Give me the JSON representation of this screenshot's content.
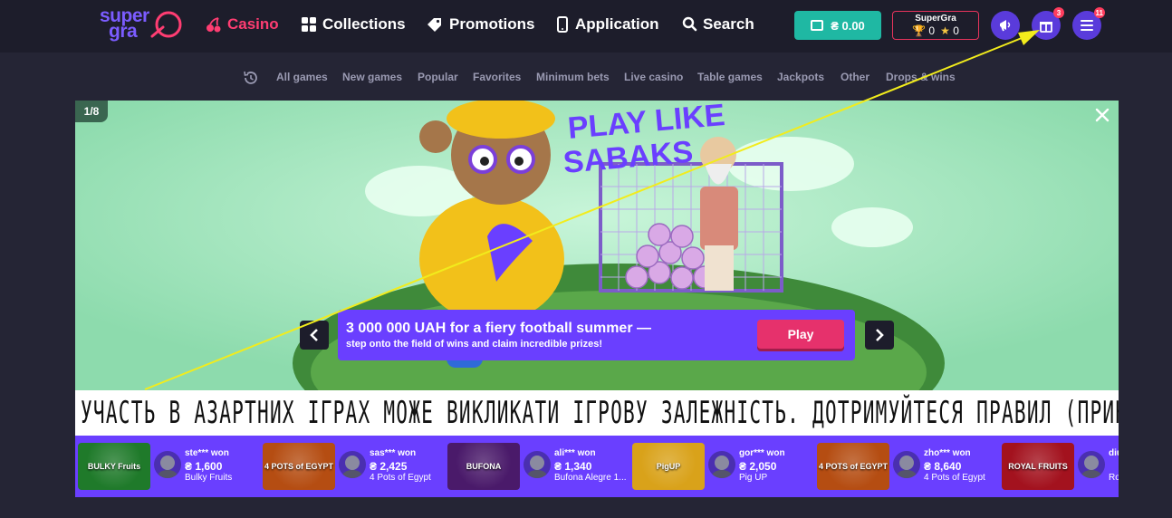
{
  "logo": {
    "line1": "super",
    "line2": "gra"
  },
  "nav": {
    "items": [
      {
        "label": "Casino",
        "icon": "cherry-icon",
        "active": true
      },
      {
        "label": "Collections",
        "icon": "grid-icon"
      },
      {
        "label": "Promotions",
        "icon": "tag-icon"
      },
      {
        "label": "Application",
        "icon": "phone-icon"
      },
      {
        "label": "Search",
        "icon": "search-icon"
      }
    ]
  },
  "account": {
    "balance": "₴ 0.00",
    "profile_name": "SuperGra",
    "trophies": "0",
    "stars": "0",
    "gifts_badge": "3",
    "menu_badge": "11"
  },
  "subnav": {
    "items": [
      "All games",
      "New games",
      "Popular",
      "Favorites",
      "Minimum bets",
      "Live casino",
      "Table games",
      "Jackpots",
      "Other",
      "Drops & wins"
    ]
  },
  "banner": {
    "counter": "1/8",
    "headline": "PLAY LIKE SABAKS",
    "promo_title": "3 000 000 UAH for a fiery football summer —",
    "promo_subtitle": "step onto the field of wins and claim incredible prizes!",
    "play_label": "Play",
    "warning": "УЧАСТЬ В АЗАРТНИХ ІГРАХ МОЖЕ ВИКЛИКАТИ ІГРОВУ ЗАЛЕЖНІСТЬ. ДОТРИМУЙТЕСЯ ПРАВИЛ (ПРИНЦИПІВ) ВІДПОВІДАЛЬНОЇ ГРИ"
  },
  "wins": [
    {
      "user": "ste*** won",
      "amount": "₴ 1,600",
      "game": "Bulky Fruits",
      "thumb_color": "#1f7a2a"
    },
    {
      "user": "sas*** won",
      "amount": "₴ 2,425",
      "game": "4 Pots of Egypt",
      "thumb_color": "#b54d12"
    },
    {
      "user": "ali*** won",
      "amount": "₴ 1,340",
      "game": "Bufona Alegre 1...",
      "thumb_color": "#4a1a6a"
    },
    {
      "user": "gor*** won",
      "amount": "₴ 2,050",
      "game": "Pig UP",
      "thumb_color": "#d9a21a"
    },
    {
      "user": "zho*** won",
      "amount": "₴ 8,640",
      "game": "4 Pots of Egypt",
      "thumb_color": "#b54d12"
    },
    {
      "user": "diu",
      "amount": "",
      "game": "Ro",
      "thumb_color": "#a3121e"
    }
  ],
  "win_thumb_labels": [
    "BULKY Fruits",
    "4 POTS of EGYPT",
    "BUFONA",
    "PigUP",
    "4 POTS of EGYPT",
    "ROYAL FRUITS"
  ]
}
